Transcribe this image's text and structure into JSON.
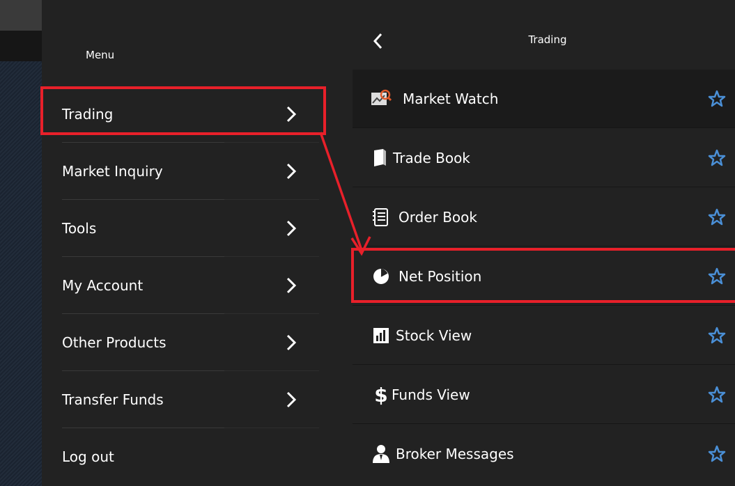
{
  "menu": {
    "title": "Menu",
    "items": [
      {
        "label": "Trading"
      },
      {
        "label": "Market Inquiry"
      },
      {
        "label": "Tools"
      },
      {
        "label": "My Account"
      },
      {
        "label": "Other Products"
      },
      {
        "label": "Transfer Funds"
      },
      {
        "label": "Log out"
      }
    ]
  },
  "submenu": {
    "title": "Trading",
    "items": [
      {
        "label": "Market Watch",
        "icon": "chart-magnifier-icon"
      },
      {
        "label": "Trade Book",
        "icon": "book-icon"
      },
      {
        "label": "Order Book",
        "icon": "notebook-icon"
      },
      {
        "label": "Net Position",
        "icon": "pie-chart-icon"
      },
      {
        "label": "Stock View",
        "icon": "bar-chart-icon"
      },
      {
        "label": "Funds View",
        "icon": "dollar-icon"
      },
      {
        "label": "Broker Messages",
        "icon": "broker-user-icon"
      }
    ]
  },
  "colors": {
    "panel_bg": "#222222",
    "highlight": "#e8202a",
    "star": "#4a8fd6"
  }
}
